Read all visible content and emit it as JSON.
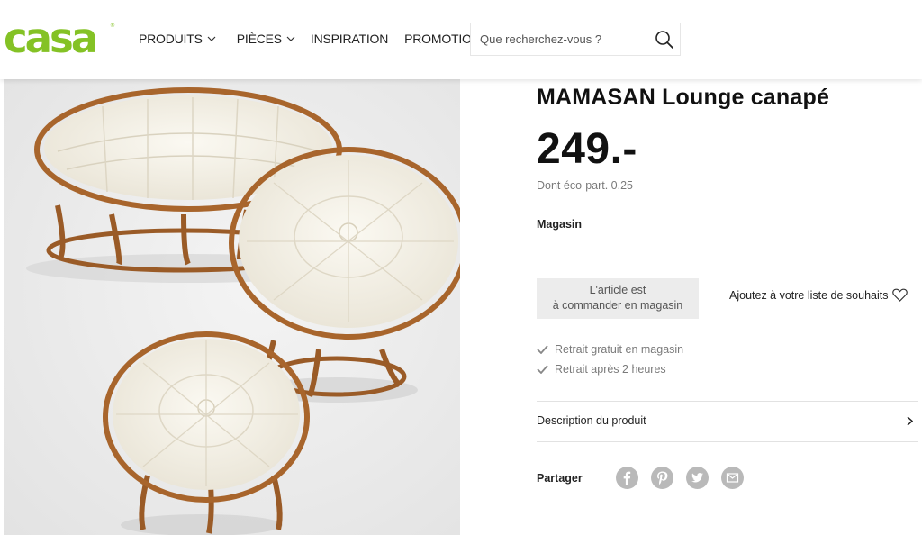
{
  "brand": {
    "logo_text": "casa",
    "accent": "#84c225"
  },
  "nav": {
    "items": [
      {
        "label": "PRODUITS",
        "has_dropdown": true,
        "icon": "chevron-down-icon"
      },
      {
        "label": "PIÈCES",
        "has_dropdown": true,
        "icon": "chevron-down-icon"
      },
      {
        "label": "INSPIRATION",
        "has_dropdown": false
      },
      {
        "label": "PROMOTIONS",
        "has_dropdown": false
      }
    ]
  },
  "search": {
    "placeholder": "Que recherchez-vous ?",
    "value": "",
    "icon": "search-icon"
  },
  "product": {
    "image_icon": "product-photo",
    "title": "MAMASAN Lounge canapé",
    "price": "249.-",
    "eco_participation": "Dont éco-part. 0.25",
    "store_label": "Magasin",
    "availability_line1": "L'article est",
    "availability_line2": "à commander en magasin",
    "wishlist_label": "Ajoutez à votre liste de souhaits",
    "wishlist_icon": "heart-icon",
    "benefits": [
      {
        "label": "Retrait gratuit en magasin",
        "icon": "check-icon"
      },
      {
        "label": "Retrait après 2 heures",
        "icon": "check-icon"
      }
    ],
    "description_label": "Description du produit",
    "description_icon": "chevron-right-icon"
  },
  "share": {
    "label": "Partager",
    "icons": [
      "facebook-icon",
      "pinterest-icon",
      "twitter-icon",
      "mail-icon"
    ],
    "icon_color": "#b9b9b9"
  }
}
